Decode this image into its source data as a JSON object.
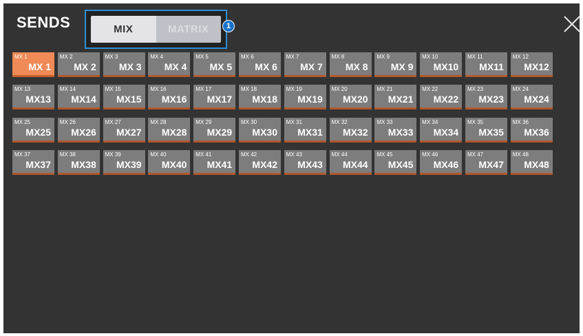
{
  "header": {
    "title": "SENDS",
    "callout_number": "1"
  },
  "tabs": [
    {
      "label": "MIX",
      "active": true
    },
    {
      "label": "MATRIX",
      "active": false
    }
  ],
  "close_icon": "close-x-icon",
  "colors": {
    "panel_bg": "#333333",
    "button_bg": "#7d7d7d",
    "button_selected_bg": "#f08a56",
    "button_underline": "#b0582c",
    "highlight_border": "#2b8fd6",
    "callout_bg": "#1a73c9"
  },
  "selected_index": 0,
  "buttons": [
    {
      "name": "MX 1",
      "label": "MX 1"
    },
    {
      "name": "MX 2",
      "label": "MX 2"
    },
    {
      "name": "MX 3",
      "label": "MX 3"
    },
    {
      "name": "MX 4",
      "label": "MX 4"
    },
    {
      "name": "MX 5",
      "label": "MX 5"
    },
    {
      "name": "MX 6",
      "label": "MX 6"
    },
    {
      "name": "MX 7",
      "label": "MX 7"
    },
    {
      "name": "MX 8",
      "label": "MX 8"
    },
    {
      "name": "MX 9",
      "label": "MX 9"
    },
    {
      "name": "MX 10",
      "label": "MX10"
    },
    {
      "name": "MX 11",
      "label": "MX11"
    },
    {
      "name": "MX 12",
      "label": "MX12"
    },
    {
      "name": "MX 13",
      "label": "MX13"
    },
    {
      "name": "MX 14",
      "label": "MX14"
    },
    {
      "name": "MX 15",
      "label": "MX15"
    },
    {
      "name": "MX 16",
      "label": "MX16"
    },
    {
      "name": "MX 17",
      "label": "MX17"
    },
    {
      "name": "MX 18",
      "label": "MX18"
    },
    {
      "name": "MX 19",
      "label": "MX19"
    },
    {
      "name": "MX 20",
      "label": "MX20"
    },
    {
      "name": "MX 21",
      "label": "MX21"
    },
    {
      "name": "MX 22",
      "label": "MX22"
    },
    {
      "name": "MX 23",
      "label": "MX23"
    },
    {
      "name": "MX 24",
      "label": "MX24"
    },
    {
      "name": "MX 25",
      "label": "MX25"
    },
    {
      "name": "MX 26",
      "label": "MX26"
    },
    {
      "name": "MX 27",
      "label": "MX27"
    },
    {
      "name": "MX 28",
      "label": "MX28"
    },
    {
      "name": "MX 29",
      "label": "MX29"
    },
    {
      "name": "MX 30",
      "label": "MX30"
    },
    {
      "name": "MX 31",
      "label": "MX31"
    },
    {
      "name": "MX 32",
      "label": "MX32"
    },
    {
      "name": "MX 33",
      "label": "MX33"
    },
    {
      "name": "MX 34",
      "label": "MX34"
    },
    {
      "name": "MX 35",
      "label": "MX35"
    },
    {
      "name": "MX 36",
      "label": "MX36"
    },
    {
      "name": "MX 37",
      "label": "MX37"
    },
    {
      "name": "MX 38",
      "label": "MX38"
    },
    {
      "name": "MX 39",
      "label": "MX39"
    },
    {
      "name": "MX 40",
      "label": "MX40"
    },
    {
      "name": "MX 41",
      "label": "MX41"
    },
    {
      "name": "MX 42",
      "label": "MX42"
    },
    {
      "name": "MX 43",
      "label": "MX43"
    },
    {
      "name": "MX 44",
      "label": "MX44"
    },
    {
      "name": "MX 45",
      "label": "MX45"
    },
    {
      "name": "MX 46",
      "label": "MX46"
    },
    {
      "name": "MX 47",
      "label": "MX47"
    },
    {
      "name": "MX 48",
      "label": "MX48"
    }
  ]
}
